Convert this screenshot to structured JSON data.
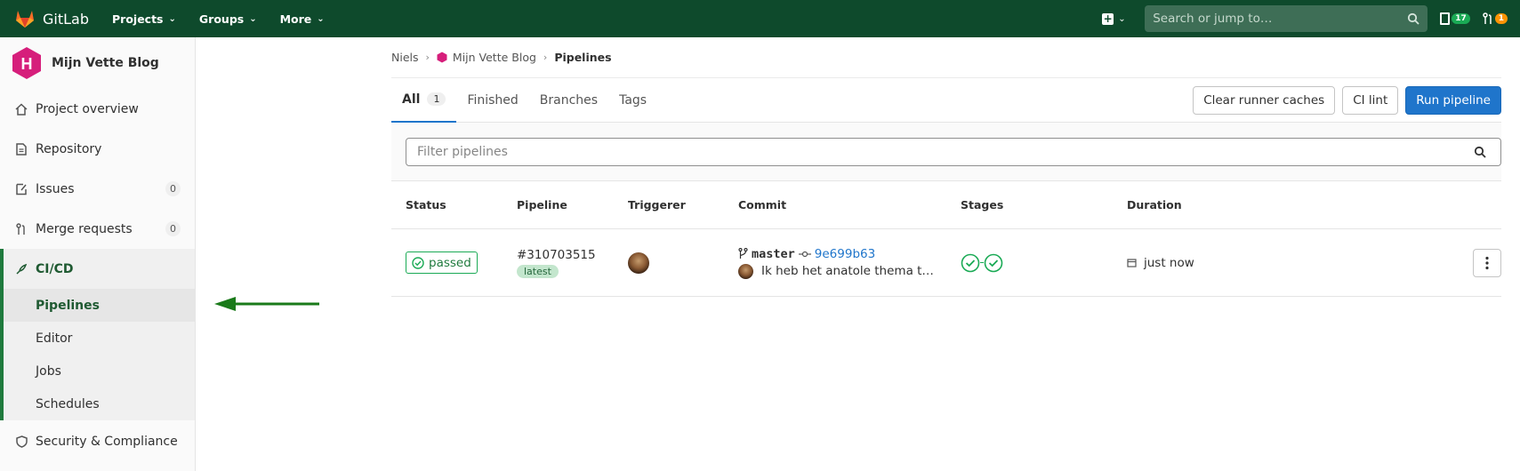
{
  "navbar": {
    "brand": "GitLab",
    "menus": [
      "Projects",
      "Groups",
      "More"
    ],
    "search_placeholder": "Search or jump to…",
    "todo_count": "17",
    "mr_count": "1"
  },
  "sidebar": {
    "project_avatar_letter": "H",
    "project_name": "Mijn Vette Blog",
    "items": [
      {
        "label": "Project overview",
        "icon": "home-icon"
      },
      {
        "label": "Repository",
        "icon": "document-icon"
      },
      {
        "label": "Issues",
        "icon": "issues-icon",
        "count": "0"
      },
      {
        "label": "Merge requests",
        "icon": "merge-request-icon",
        "count": "0"
      }
    ],
    "cicd": {
      "label": "CI/CD",
      "icon": "rocket-icon",
      "subitems": [
        "Pipelines",
        "Editor",
        "Jobs",
        "Schedules"
      ],
      "active": "Pipelines"
    },
    "after": [
      {
        "label": "Security & Compliance",
        "icon": "shield-icon"
      }
    ]
  },
  "breadcrumb": {
    "items": [
      "Niels",
      "Mijn Vette Blog",
      "Pipelines"
    ]
  },
  "tabs": {
    "items": [
      {
        "label": "All",
        "count": "1"
      },
      {
        "label": "Finished"
      },
      {
        "label": "Branches"
      },
      {
        "label": "Tags"
      }
    ],
    "actions": [
      "Clear runner caches",
      "CI lint",
      "Run pipeline"
    ]
  },
  "filter": {
    "placeholder": "Filter pipelines"
  },
  "table": {
    "headers": [
      "Status",
      "Pipeline",
      "Triggerer",
      "Commit",
      "Stages",
      "Duration"
    ],
    "rows": [
      {
        "status": "passed",
        "pipeline_id": "#310703515",
        "pipeline_badge": "latest",
        "branch": "master",
        "sha": "9e699b63",
        "message": "Ik heb het anatole thema t…",
        "duration": "just now"
      }
    ]
  },
  "colors": {
    "navbar": "#0e4a2c",
    "accent": "#1f75cb",
    "success": "#1aaa55",
    "annotation_arrow": "#1a7a1a"
  }
}
